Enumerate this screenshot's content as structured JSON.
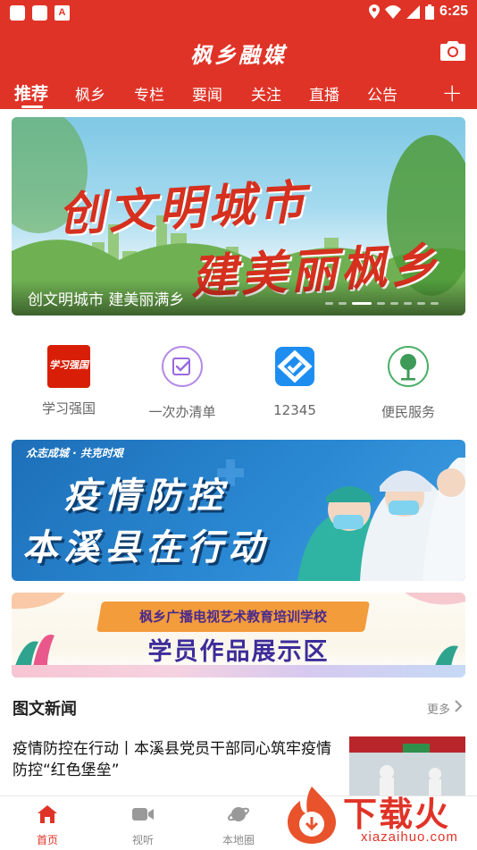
{
  "status_bar": {
    "time": "6:25",
    "notification_letter": "A"
  },
  "header": {
    "brand": "枫乡融媒",
    "tabs": [
      {
        "label": "推荐",
        "active": true
      },
      {
        "label": "枫乡"
      },
      {
        "label": "专栏"
      },
      {
        "label": "要闻"
      },
      {
        "label": "关注"
      },
      {
        "label": "直播"
      },
      {
        "label": "公告"
      }
    ],
    "add_tab_symbol": "+"
  },
  "banner": {
    "line1": "创文明城市",
    "line2": "建美丽枫乡",
    "caption": "创文明城市 建美丽满乡",
    "slide_count": 8,
    "active_slide": 2
  },
  "quick_links": [
    {
      "label": "学习强国",
      "icon": "xuexi-qiangguo-logo-icon",
      "logo_text": "学习强国"
    },
    {
      "label": "一次办清单",
      "icon": "checklist-icon"
    },
    {
      "label": "12345",
      "icon": "hotline-app-icon"
    },
    {
      "label": "便民服务",
      "icon": "tree-icon"
    }
  ],
  "promo_epidemic": {
    "tag": "众志成城 · 共克时艰",
    "line1": "疫情防控",
    "line2": "本溪县在行动"
  },
  "promo_school": {
    "top": "枫乡广播电视艺术教育培训学校",
    "main": "学员作品展示区"
  },
  "news_section": {
    "title": "图文新闻",
    "more": "更多",
    "items": [
      {
        "title": "疫情防控在行动丨本溪县党员干部同心筑牢疫情防控“红色堡垒”"
      }
    ]
  },
  "tabbar": [
    {
      "label": "首页",
      "icon": "home-icon",
      "active": true
    },
    {
      "label": "视听",
      "icon": "video-icon"
    },
    {
      "label": "本地圈",
      "icon": "planet-icon"
    }
  ],
  "watermark": {
    "text": "下载火",
    "sub": "xiazaihuo.com"
  },
  "colors": {
    "brand_red": "#e03327",
    "banner_text_red": "#d6301f",
    "promo_blue": "#1d6fb8",
    "school_purple": "#3d2c9a"
  }
}
